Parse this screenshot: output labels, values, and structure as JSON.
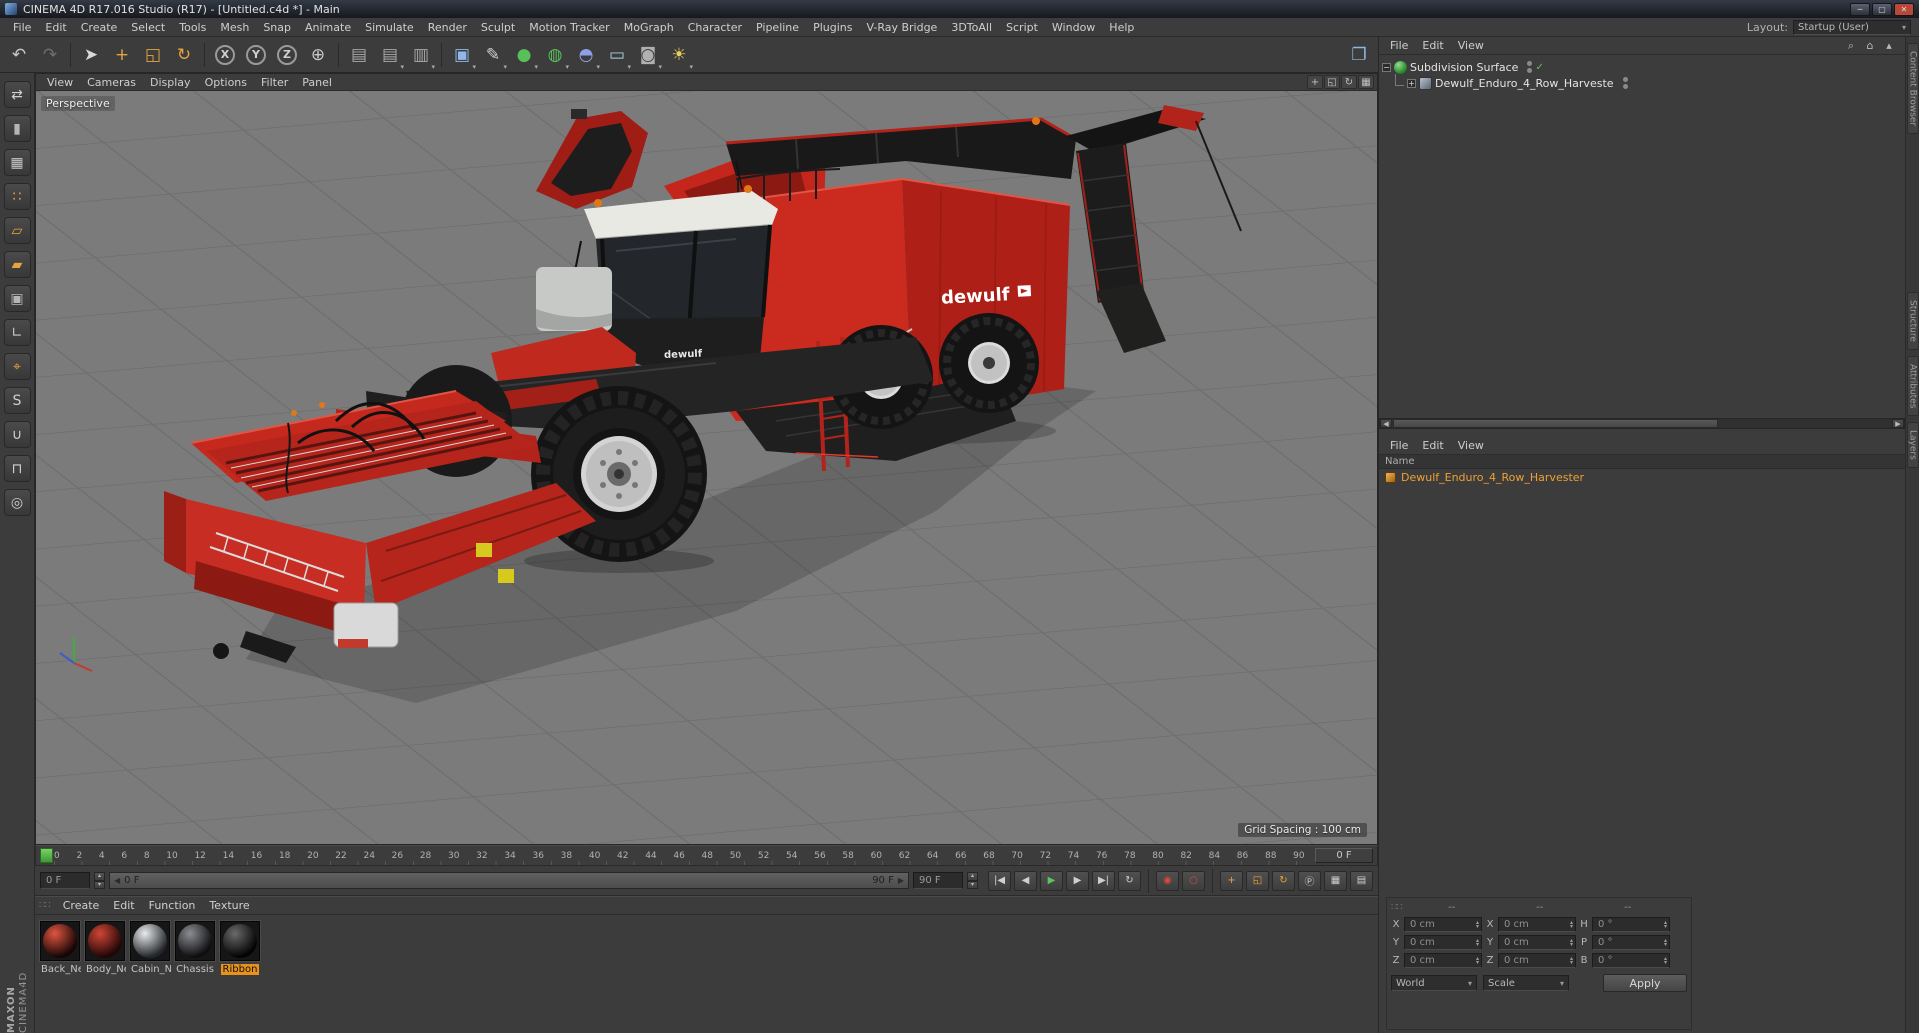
{
  "colors": {
    "accent_orange": "#e8921e",
    "selection_green": "#5fc15f",
    "viewport_bg": "#7b7b7b",
    "panel_bg": "#3c3c3c",
    "machine_red": "#c5251f"
  },
  "icons": {
    "down": "▾",
    "up": "▴",
    "left": "◀",
    "right": "▶",
    "minus": "−",
    "plus": "+",
    "check": "✓",
    "grip": "∷∷"
  },
  "window": {
    "title": "CINEMA 4D R17.016 Studio (R17) - [Untitled.c4d *] - Main",
    "controls": [
      {
        "n": "minimize-button",
        "g": "─"
      },
      {
        "n": "maximize-button",
        "g": "▢"
      },
      {
        "n": "close-button",
        "g": "✕",
        "bg": "#b8493a"
      }
    ]
  },
  "menubar": {
    "items": [
      "File",
      "Edit",
      "Create",
      "Select",
      "Tools",
      "Mesh",
      "Snap",
      "Animate",
      "Simulate",
      "Render",
      "Sculpt",
      "Motion Tracker",
      "MoGraph",
      "Character",
      "Pipeline",
      "Plugins",
      "V-Ray Bridge",
      "3DToAll",
      "Script",
      "Window",
      "Help"
    ],
    "layout_label": "Layout:",
    "layout_value": "Startup (User)"
  },
  "toolbar": {
    "items": [
      {
        "n": "undo-button",
        "g": "↶",
        "c": "#c8c8c8"
      },
      {
        "n": "redo-button",
        "g": "↷",
        "c": "#707070"
      },
      {
        "sep": true
      },
      {
        "n": "live-selection-tool",
        "g": "➤",
        "c": "#d8d8d8"
      },
      {
        "n": "move-tool",
        "g": "+",
        "c": "#e8a33d"
      },
      {
        "n": "scale-tool",
        "g": "◱",
        "c": "#e8a33d"
      },
      {
        "n": "rotate-tool",
        "g": "↻",
        "c": "#e8a33d"
      },
      {
        "sep": true
      },
      {
        "n": "lock-x-axis-button",
        "g": "X",
        "c": "#d0d0d0",
        "circle": true
      },
      {
        "n": "lock-y-axis-button",
        "g": "Y",
        "c": "#d0d0d0",
        "circle": true
      },
      {
        "n": "lock-z-axis-button",
        "g": "Z",
        "c": "#d0d0d0",
        "circle": true
      },
      {
        "n": "coordinate-system-button",
        "g": "⊕",
        "c": "#c8c8c8"
      },
      {
        "sep": true
      },
      {
        "n": "render-view-button",
        "g": "▤",
        "c": "#a8a8a8"
      },
      {
        "n": "render-picture-viewer-button",
        "g": "▤",
        "c": "#a8a8a8",
        "dd": true
      },
      {
        "n": "render-settings-button",
        "g": "▥",
        "c": "#a8a8a8",
        "dd": true
      },
      {
        "sep": true
      },
      {
        "n": "add-cube-button",
        "g": "▣",
        "c": "#8fb8e8",
        "dd": true
      },
      {
        "n": "pen-tool-button",
        "g": "✎",
        "c": "#d0d0d0",
        "dd": true
      },
      {
        "n": "subdivision-surface-button",
        "g": "●",
        "c": "#58c058",
        "dd": true
      },
      {
        "n": "mograph-button",
        "g": "◍",
        "c": "#58c058",
        "dd": true
      },
      {
        "n": "deformer-button",
        "g": "◓",
        "c": "#8f9fe8",
        "dd": true
      },
      {
        "n": "environment-button",
        "g": "▭",
        "c": "#a8d0e0",
        "dd": true
      },
      {
        "n": "camera-button",
        "g": "◙",
        "c": "#b0b0b0",
        "dd": true
      },
      {
        "n": "light-button",
        "g": "☀",
        "c": "#e8d060",
        "dd": true
      }
    ],
    "right_icon": {
      "n": "layout-panel-icon",
      "g": "❐"
    }
  },
  "left_toolbar": {
    "items": [
      {
        "n": "make-editable-button",
        "g": "⇄",
        "c": "#cfcfcf"
      },
      {
        "n": "model-mode-button",
        "g": "▮",
        "c": "#b5b5b5"
      },
      {
        "n": "texture-mode-button",
        "g": "▦",
        "c": "#c8c8c8"
      },
      {
        "n": "points-mode-button",
        "g": "∷",
        "c": "#e8a33d"
      },
      {
        "n": "edges-mode-button",
        "g": "▱",
        "c": "#e8a33d"
      },
      {
        "n": "polygons-mode-button",
        "g": "▰",
        "c": "#e8a33d"
      },
      {
        "n": "object-mode-button",
        "g": "▣",
        "c": "#b5b5b5"
      },
      {
        "n": "workplane-mode-button",
        "g": "∟",
        "c": "#c8c8c8"
      },
      {
        "n": "axis-mode-button",
        "g": "⌖",
        "c": "#e8a33d"
      },
      {
        "n": "solo-mode-button",
        "g": "S",
        "c": "#cfcfcf"
      },
      {
        "n": "snap-magnet-button",
        "g": "∪",
        "c": "#cfcfcf"
      },
      {
        "n": "workplane-lock-button",
        "g": "⊓",
        "c": "#cfcfcf"
      },
      {
        "n": "spline-smooth-button",
        "g": "◎",
        "c": "#cfcfcf"
      }
    ]
  },
  "viewport": {
    "menu": [
      "View",
      "Cameras",
      "Display",
      "Options",
      "Filter",
      "Panel"
    ],
    "nav": [
      {
        "n": "pan-view-icon",
        "g": "+"
      },
      {
        "n": "zoom-view-icon",
        "g": "◱"
      },
      {
        "n": "rotate-view-icon",
        "g": "↻"
      },
      {
        "n": "toggle-view-icon",
        "g": "▦"
      }
    ],
    "view_label": "Perspective",
    "grid_spacing": "Grid Spacing : 100 cm",
    "machine_brand": "dewulf"
  },
  "object_manager": {
    "menu": [
      "File",
      "Edit",
      "View"
    ],
    "icons": [
      {
        "n": "search-icon",
        "g": "⌕"
      },
      {
        "n": "home-icon",
        "g": "⌂"
      },
      {
        "n": "up-level-icon",
        "g": "▴"
      }
    ],
    "items": [
      {
        "label": "Subdivision Surface"
      },
      {
        "label": "Dewulf_Enduro_4_Row_Harveste"
      }
    ]
  },
  "name_panel": {
    "menu": [
      "File",
      "Edit",
      "View"
    ],
    "header": "Name",
    "items": [
      {
        "label": "Dewulf_Enduro_4_Row_Harvester"
      }
    ]
  },
  "side_tabs": [
    "Content Browser",
    "Structure",
    "Attributes",
    "Layers"
  ],
  "timeline": {
    "ticks": [
      0,
      2,
      4,
      6,
      8,
      10,
      12,
      14,
      16,
      18,
      20,
      22,
      24,
      26,
      28,
      30,
      32,
      34,
      36,
      38,
      40,
      42,
      44,
      46,
      48,
      50,
      52,
      54,
      56,
      58,
      60,
      62,
      64,
      66,
      68,
      70,
      72,
      74,
      76,
      78,
      80,
      82,
      84,
      86,
      88,
      90
    ],
    "current_frame": "0 F",
    "start_field": "0 F",
    "end_field": "90 F",
    "slider_start": "0 F",
    "slider_end": "90 F"
  },
  "transport": {
    "buttons": [
      {
        "n": "goto-start-button",
        "g": "|◀"
      },
      {
        "n": "prev-frame-button",
        "g": "◀"
      },
      {
        "n": "play-button",
        "g": "▶",
        "c": "#5fc15f"
      },
      {
        "n": "next-frame-button",
        "g": "▶"
      },
      {
        "n": "goto-end-button",
        "g": "▶|"
      },
      {
        "n": "cycle-button",
        "g": "↻"
      },
      {
        "sep": true
      },
      {
        "n": "record-keyframe-button",
        "g": "◉",
        "c": "#d84a3a"
      },
      {
        "n": "autokey-button",
        "g": "○",
        "c": "#d84a3a"
      },
      {
        "sep": true
      },
      {
        "n": "record-position-button",
        "g": "+",
        "c": "#e8a33d"
      },
      {
        "n": "record-scale-button",
        "g": "◱",
        "c": "#e8a33d"
      },
      {
        "n": "record-rotation-button",
        "g": "↻",
        "c": "#e8a33d"
      },
      {
        "n": "record-parameter-button",
        "g": "Ⓟ",
        "c": "#cfcfcf"
      },
      {
        "n": "record-pla-button",
        "g": "▦",
        "c": "#cfcfcf"
      },
      {
        "n": "timeline-layout-button",
        "g": "▤",
        "c": "#cfcfcf"
      }
    ]
  },
  "materials": {
    "menu": [
      "Create",
      "Edit",
      "Function",
      "Texture"
    ],
    "items": [
      {
        "label": "Back_Ne",
        "c1": "#e05540",
        "c2": "#150505"
      },
      {
        "label": "Body_Ne",
        "c1": "#d04535",
        "c2": "#200606"
      },
      {
        "label": "Cabin_N",
        "c1": "#e8eaec",
        "c2": "#23262a"
      },
      {
        "label": "Chassis",
        "c1": "#8a8d92",
        "c2": "#0e0e10"
      },
      {
        "label": "Ribbon",
        "c1": "#6a6a6a",
        "c2": "#030303",
        "selected": true
      }
    ]
  },
  "coordinates": {
    "headers": [
      "--",
      "--",
      "--"
    ],
    "rows": [
      {
        "a": "X",
        "av": "0 cm",
        "b": "X",
        "bv": "0 cm",
        "c": "H",
        "cv": "0 °"
      },
      {
        "a": "Y",
        "av": "0 cm",
        "b": "Y",
        "bv": "0 cm",
        "c": "P",
        "cv": "0 °"
      },
      {
        "a": "Z",
        "av": "0 cm",
        "b": "Z",
        "bv": "0 cm",
        "c": "B",
        "cv": "0 °"
      }
    ],
    "dropdown_left": "World",
    "dropdown_right": "Scale",
    "apply": "Apply"
  },
  "brand": {
    "maxon": "MAXON",
    "cinema": "CINEMA4D"
  }
}
